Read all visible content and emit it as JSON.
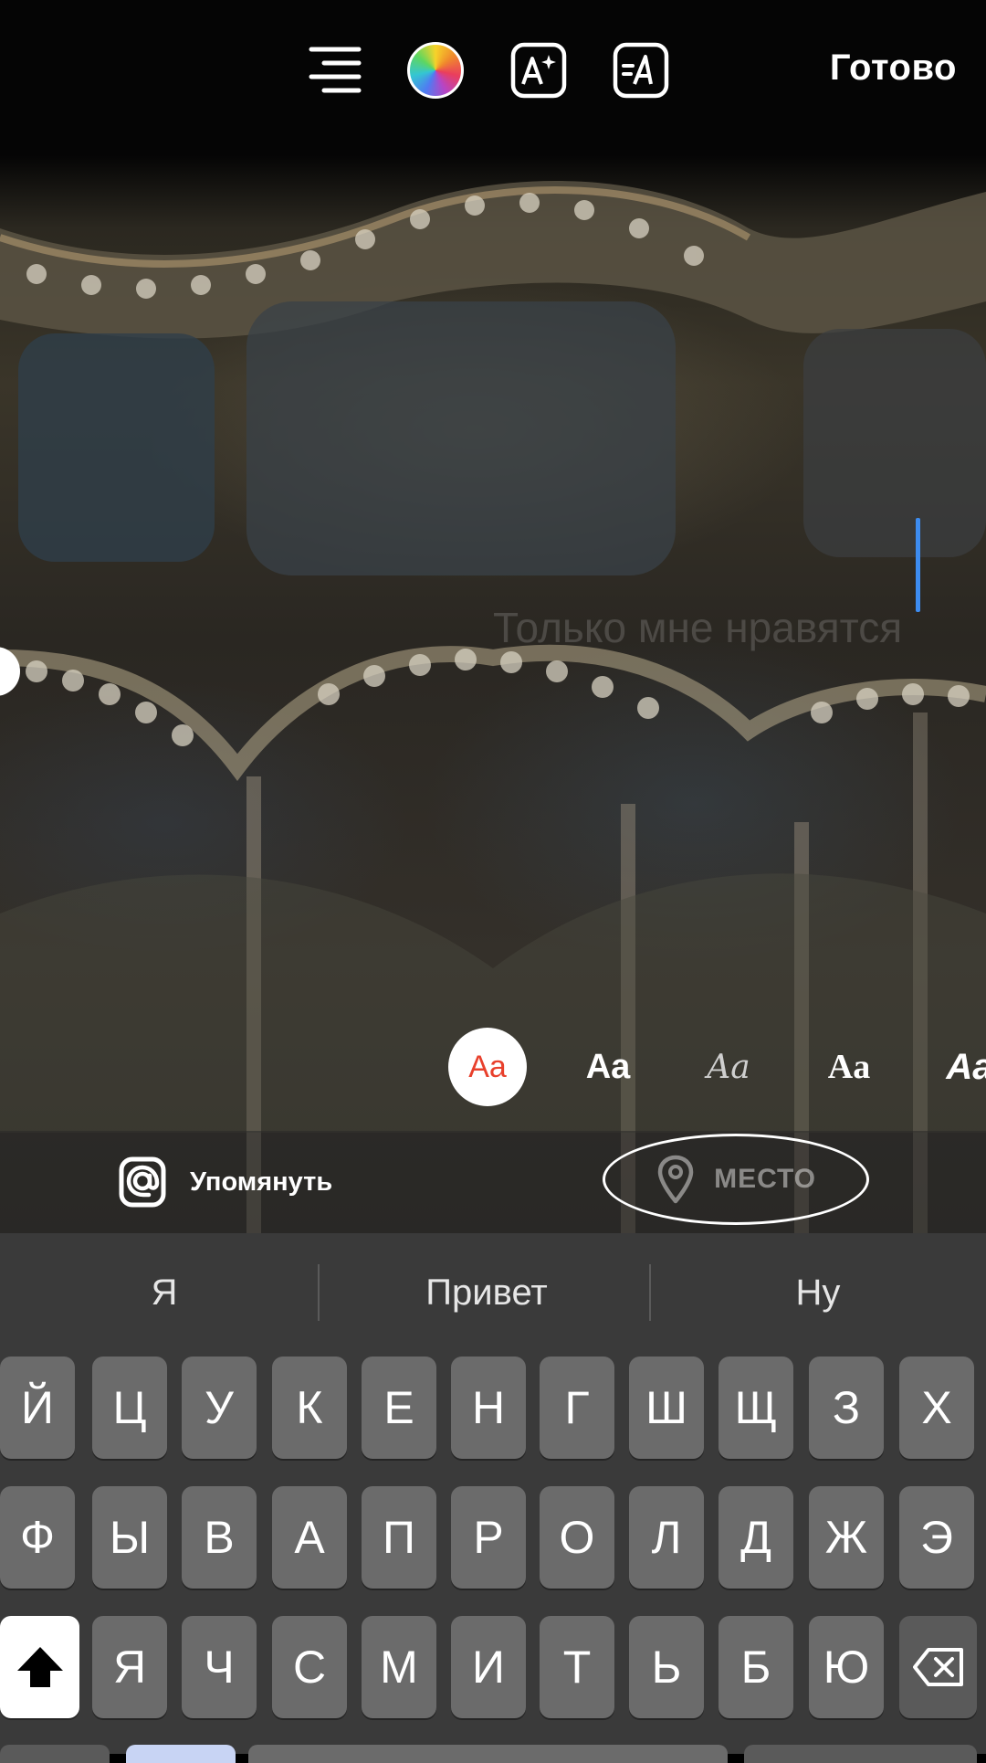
{
  "toolbar": {
    "tools": [
      {
        "icon": "align-right-icon"
      },
      {
        "icon": "color-wheel-icon"
      },
      {
        "icon": "text-effects-icon"
      },
      {
        "icon": "text-animation-icon"
      }
    ],
    "done_label": "Готово"
  },
  "editor": {
    "placeholder": "Только мне нравятся"
  },
  "fonts": [
    {
      "label": "Aa",
      "style": "modern",
      "selected": true
    },
    {
      "label": "Aa",
      "style": "classic-bold",
      "selected": false
    },
    {
      "label": "Aa",
      "style": "script",
      "selected": false
    },
    {
      "label": "Aa",
      "style": "serif-bold",
      "selected": false
    },
    {
      "label": "Aa",
      "style": "italic-bold",
      "selected": false
    }
  ],
  "chips": {
    "mention_label": "Упомянуть",
    "location_label": "МЕСТО"
  },
  "keyboard": {
    "suggestions": [
      "Я",
      "Привет",
      "Ну"
    ],
    "row1": [
      "Й",
      "Ц",
      "У",
      "К",
      "Е",
      "Н",
      "Г",
      "Ш",
      "Щ",
      "З",
      "Х"
    ],
    "row2": [
      "Ф",
      "Ы",
      "В",
      "А",
      "П",
      "Р",
      "О",
      "Л",
      "Д",
      "Ж",
      "Э"
    ],
    "row3": [
      "Я",
      "Ч",
      "С",
      "М",
      "И",
      "Т",
      "Ь",
      "Б",
      "Ю"
    ]
  },
  "colors": {
    "accent_cursor": "#3d8cf0",
    "selected_font_text": "#e8402c",
    "key_bg": "#6b6b6b",
    "keyboard_bg": "#3a3a3a"
  }
}
